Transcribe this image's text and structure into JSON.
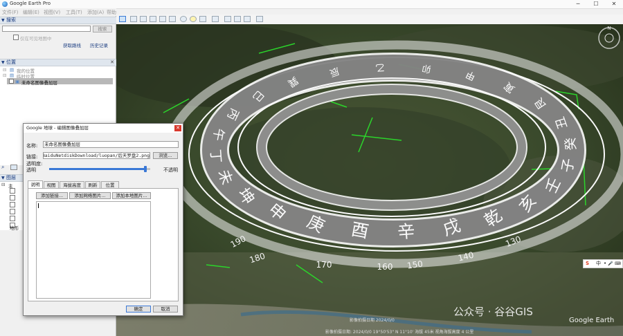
{
  "window": {
    "title": "Google Earth Pro",
    "minimize": "─",
    "maximize": "☐",
    "close": "✕"
  },
  "menu": [
    "文件(F)",
    "编辑(E)",
    "视图(V)",
    "工具(T)",
    "添加(A)",
    "帮助(H)"
  ],
  "search": {
    "header": "搜索",
    "button": "搜索",
    "checkbox_label": "仅在可见地图中",
    "link_route": "获取路线",
    "link_history": "历史记录"
  },
  "places": {
    "header": "位置",
    "items": [
      "我的位置",
      "临时位置",
      "未命名图像叠加层"
    ]
  },
  "layers": {
    "header": "图层",
    "items": [
      "主",
      "",
      "",
      "",
      "",
      "",
      "地形"
    ]
  },
  "dialog": {
    "title": "Google 地球 - 编辑图像叠加层",
    "name_label": "名称:",
    "name_value": "未命名图像叠加层",
    "link_label": "链接:",
    "link_value": "r:/BaiduNetdiskDownload/luopan/后天罗盘2.png",
    "browse_button": "浏览...",
    "opacity_label": "透明度:",
    "opacity_left": "透明",
    "opacity_right": "不透明",
    "opacity_value": 0.95,
    "tabs": [
      "说明",
      "视图",
      "海拔高度",
      "刷新",
      "位置"
    ],
    "btn_add_link": "添加链接...",
    "btn_add_web_image": "添加网络图片...",
    "btn_add_local_image": "添加本地图片...",
    "ok_button": "确定",
    "cancel_button": "取消"
  },
  "compass": {
    "outer_glyphs": [
      "庚",
      "申",
      "坤",
      "未",
      "丁",
      "午",
      "丙",
      "巳",
      "巽",
      "辰",
      "乙",
      "卯",
      "甲",
      "寅",
      "艮",
      "丑",
      "癸",
      "子",
      "壬",
      "亥",
      "乾",
      "戌",
      "辛",
      "酉"
    ],
    "degree_labels": [
      "190",
      "180",
      "170",
      "160",
      "150",
      "140",
      "130"
    ]
  },
  "overlay": {
    "ime": [
      "S",
      "中",
      "•",
      "🎤",
      "⌨"
    ],
    "watermark": "公众号 · 谷谷GIS",
    "brand": "Google Earth",
    "imagery": "影像拍摄日期 2024/0/0",
    "status": "影像拍摄日期: 2024/0/0   19°50'53\" N  11°10'  海拔 45米   视角海拔高度 4 公里"
  }
}
